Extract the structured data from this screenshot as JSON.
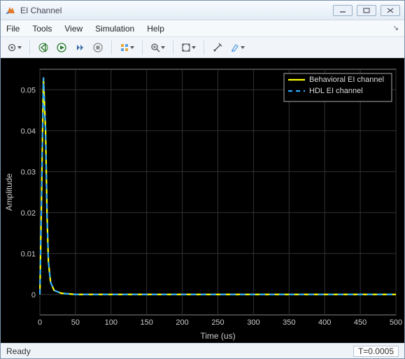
{
  "window": {
    "title": "EI Channel"
  },
  "menu": {
    "file": "File",
    "tools": "Tools",
    "view": "View",
    "simulation": "Simulation",
    "help": "Help"
  },
  "status": {
    "ready": "Ready",
    "time_label": "T=0.0005"
  },
  "chart_data": {
    "type": "line",
    "title": "",
    "xlabel": "Time (us)",
    "ylabel": "Amplitude",
    "xlim": [
      0,
      500
    ],
    "ylim": [
      -0.005,
      0.055
    ],
    "xticks": [
      0,
      50,
      100,
      150,
      200,
      250,
      300,
      350,
      400,
      450,
      500
    ],
    "yticks": [
      0,
      0.01,
      0.02,
      0.03,
      0.04,
      0.05
    ],
    "legend": {
      "position": "top-right",
      "entries": [
        "Behavioral EI channel",
        "HDL EI channel"
      ]
    },
    "series": [
      {
        "name": "Behavioral EI channel",
        "color": "#ffff00",
        "style": "solid",
        "x": [
          0,
          2,
          5,
          8,
          10,
          12,
          15,
          20,
          30,
          50,
          100,
          200,
          300,
          400,
          500
        ],
        "y": [
          0,
          0.02,
          0.053,
          0.04,
          0.02,
          0.008,
          0.003,
          0.001,
          0.0003,
          0,
          0,
          0,
          0,
          0,
          0
        ]
      },
      {
        "name": "HDL EI channel",
        "color": "#2fa9ff",
        "style": "dashed",
        "x": [
          0,
          2,
          5,
          8,
          10,
          12,
          15,
          20,
          30,
          50,
          100,
          200,
          300,
          400,
          500
        ],
        "y": [
          0,
          0.02,
          0.053,
          0.04,
          0.02,
          0.008,
          0.003,
          0.001,
          0.0003,
          0,
          0,
          0,
          0,
          0,
          0
        ]
      }
    ]
  }
}
